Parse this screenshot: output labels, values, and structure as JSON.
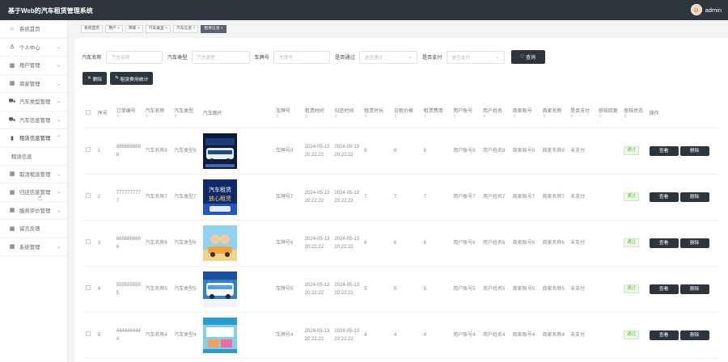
{
  "app": {
    "title": "基于Web的汽车租赁管理系统",
    "username": "admin"
  },
  "sidebar": {
    "items": [
      {
        "label": "系统首页",
        "icon": "home-icon",
        "glyph": "⌂",
        "chev": ""
      },
      {
        "label": "个人中心",
        "icon": "user-icon",
        "glyph": "♙",
        "chev": "⌄"
      },
      {
        "label": "用户管理",
        "icon": "grid-icon",
        "glyph": "▦",
        "chev": "⌄"
      },
      {
        "label": "商家管理",
        "icon": "grid-icon",
        "glyph": "▦",
        "chev": "⌄"
      },
      {
        "label": "汽车类型管理",
        "icon": "car-icon",
        "glyph": "⛟",
        "chev": "⌄"
      },
      {
        "label": "汽车信息管理",
        "icon": "car-icon",
        "glyph": "⛟",
        "chev": "⌄"
      },
      {
        "label": "租赁信息管理",
        "icon": "phone-icon",
        "glyph": "▮",
        "chev": "⌃"
      },
      {
        "label": "取消租赁管理",
        "icon": "grid-icon",
        "glyph": "▦",
        "chev": "⌄"
      },
      {
        "label": "归还信息管理",
        "icon": "grid-icon",
        "glyph": "▦",
        "chev": "⌄"
      },
      {
        "label": "服务评价管理",
        "icon": "grid-icon",
        "glyph": "▦",
        "chev": "⌄"
      },
      {
        "label": "留言反馈",
        "icon": "grid-icon",
        "glyph": "▦",
        "chev": ""
      },
      {
        "label": "系统管理",
        "icon": "grid-icon",
        "glyph": "▦",
        "chev": "⌄"
      }
    ],
    "submenu": "租赁信息"
  },
  "tabs": [
    {
      "label": "系统首页",
      "active": false
    },
    {
      "label": "用户 ×",
      "active": false
    },
    {
      "label": "商家 ×",
      "active": false
    },
    {
      "label": "汽车类型 ×",
      "active": false
    },
    {
      "label": "汽车信息 ×",
      "active": false
    },
    {
      "label": "租赁信息 ×",
      "active": true
    }
  ],
  "search": {
    "car_name_label": "汽车名称",
    "car_name_placeholder": "汽车名称",
    "car_type_label": "汽车类型",
    "car_type_placeholder": "汽车类型",
    "plate_label": "车牌号",
    "plate_placeholder": "车牌号",
    "approved_label": "是否通过",
    "approved_placeholder": "是否通过",
    "paid_label": "是否支付",
    "paid_placeholder": "是否支付",
    "query_label": "查询"
  },
  "toolbar": {
    "delete_label": "删除",
    "stats_label": "租赁费用统计"
  },
  "table": {
    "headers": [
      "序号",
      "订单编号",
      "汽车名称",
      "汽车类型",
      "汽车图片",
      "车牌号",
      "租赁时间",
      "归还时间",
      "租赁时长",
      "日租价格",
      "租赁费用",
      "用户账号",
      "用户姓名",
      "商家账号",
      "商家名称",
      "是否支付",
      "审核回复",
      "审核状态",
      "操作"
    ],
    "sortable": [
      false,
      true,
      true,
      true,
      false,
      true,
      true,
      true,
      true,
      true,
      true,
      true,
      true,
      true,
      true,
      true,
      true,
      true,
      false
    ],
    "view_label": "查看",
    "delete_label": "删除",
    "rows": [
      {
        "idx": "1",
        "order": "8888888888",
        "name": "汽车名称8",
        "type": "汽车类型8",
        "plate": "车牌号8",
        "rent_time": "2024-05-13 20:22:22",
        "return_time": "2024-05-13 20:22:22",
        "duration": "8",
        "daily": "8",
        "fee": "8",
        "user_acc": "用户账号8",
        "user_name": "用户姓名8",
        "shop_acc": "商家账号8",
        "shop_name": "商家名称8",
        "paid": "未支付",
        "reply": "",
        "status": "通过",
        "img": "bus"
      },
      {
        "idx": "2",
        "order": "7777777777",
        "name": "汽车名称7",
        "type": "汽车类型7",
        "plate": "车牌号7",
        "rent_time": "2024-05-13 20:22:22",
        "return_time": "2024-05-13 20:22:22",
        "duration": "7",
        "daily": "7",
        "fee": "7",
        "user_acc": "用户账号7",
        "user_name": "用户姓名7",
        "shop_acc": "商家账号7",
        "shop_name": "商家名称7",
        "paid": "未支付",
        "reply": "",
        "status": "通过",
        "img": "poster",
        "img_text": "汽车租赁 放心租赁"
      },
      {
        "idx": "3",
        "order": "6666666666",
        "name": "汽车名称6",
        "type": "汽车类型6",
        "plate": "车牌号6",
        "rent_time": "2024-05-13 20:22:22",
        "return_time": "2024-05-13 20:22:22",
        "duration": "6",
        "daily": "6",
        "fee": "6",
        "user_acc": "用户账号6",
        "user_name": "用户姓名6",
        "shop_acc": "商家账号6",
        "shop_name": "商家名称6",
        "paid": "未支付",
        "reply": "",
        "status": "通过",
        "img": "cartoon"
      },
      {
        "idx": "4",
        "order": "5555555555",
        "name": "汽车名称5",
        "type": "汽车类型5",
        "plate": "车牌号5",
        "rent_time": "2024-05-13 20:22:22",
        "return_time": "2024-05-13 20:22:22",
        "duration": "5",
        "daily": "5",
        "fee": "5",
        "user_acc": "用户账号5",
        "user_name": "用户姓名5",
        "shop_acc": "商家账号5",
        "shop_name": "商家名称5",
        "paid": "未支付",
        "reply": "",
        "status": "通过",
        "img": "coach"
      },
      {
        "idx": "5",
        "order": "4444444444",
        "name": "汽车名称4",
        "type": "汽车类型4",
        "plate": "车牌号4",
        "rent_time": "2024-05-13 20:22:22",
        "return_time": "2024-05-13 20:22:22",
        "duration": "4",
        "daily": "4",
        "fee": "4",
        "user_acc": "用户账号4",
        "user_name": "用户姓名4",
        "shop_acc": "商家账号4",
        "shop_name": "商家名称4",
        "paid": "未支付",
        "reply": "",
        "status": "通过",
        "img": "flyer"
      }
    ]
  },
  "colors": {
    "dark": "#2f353d",
    "badge_green": "#67c23a"
  }
}
